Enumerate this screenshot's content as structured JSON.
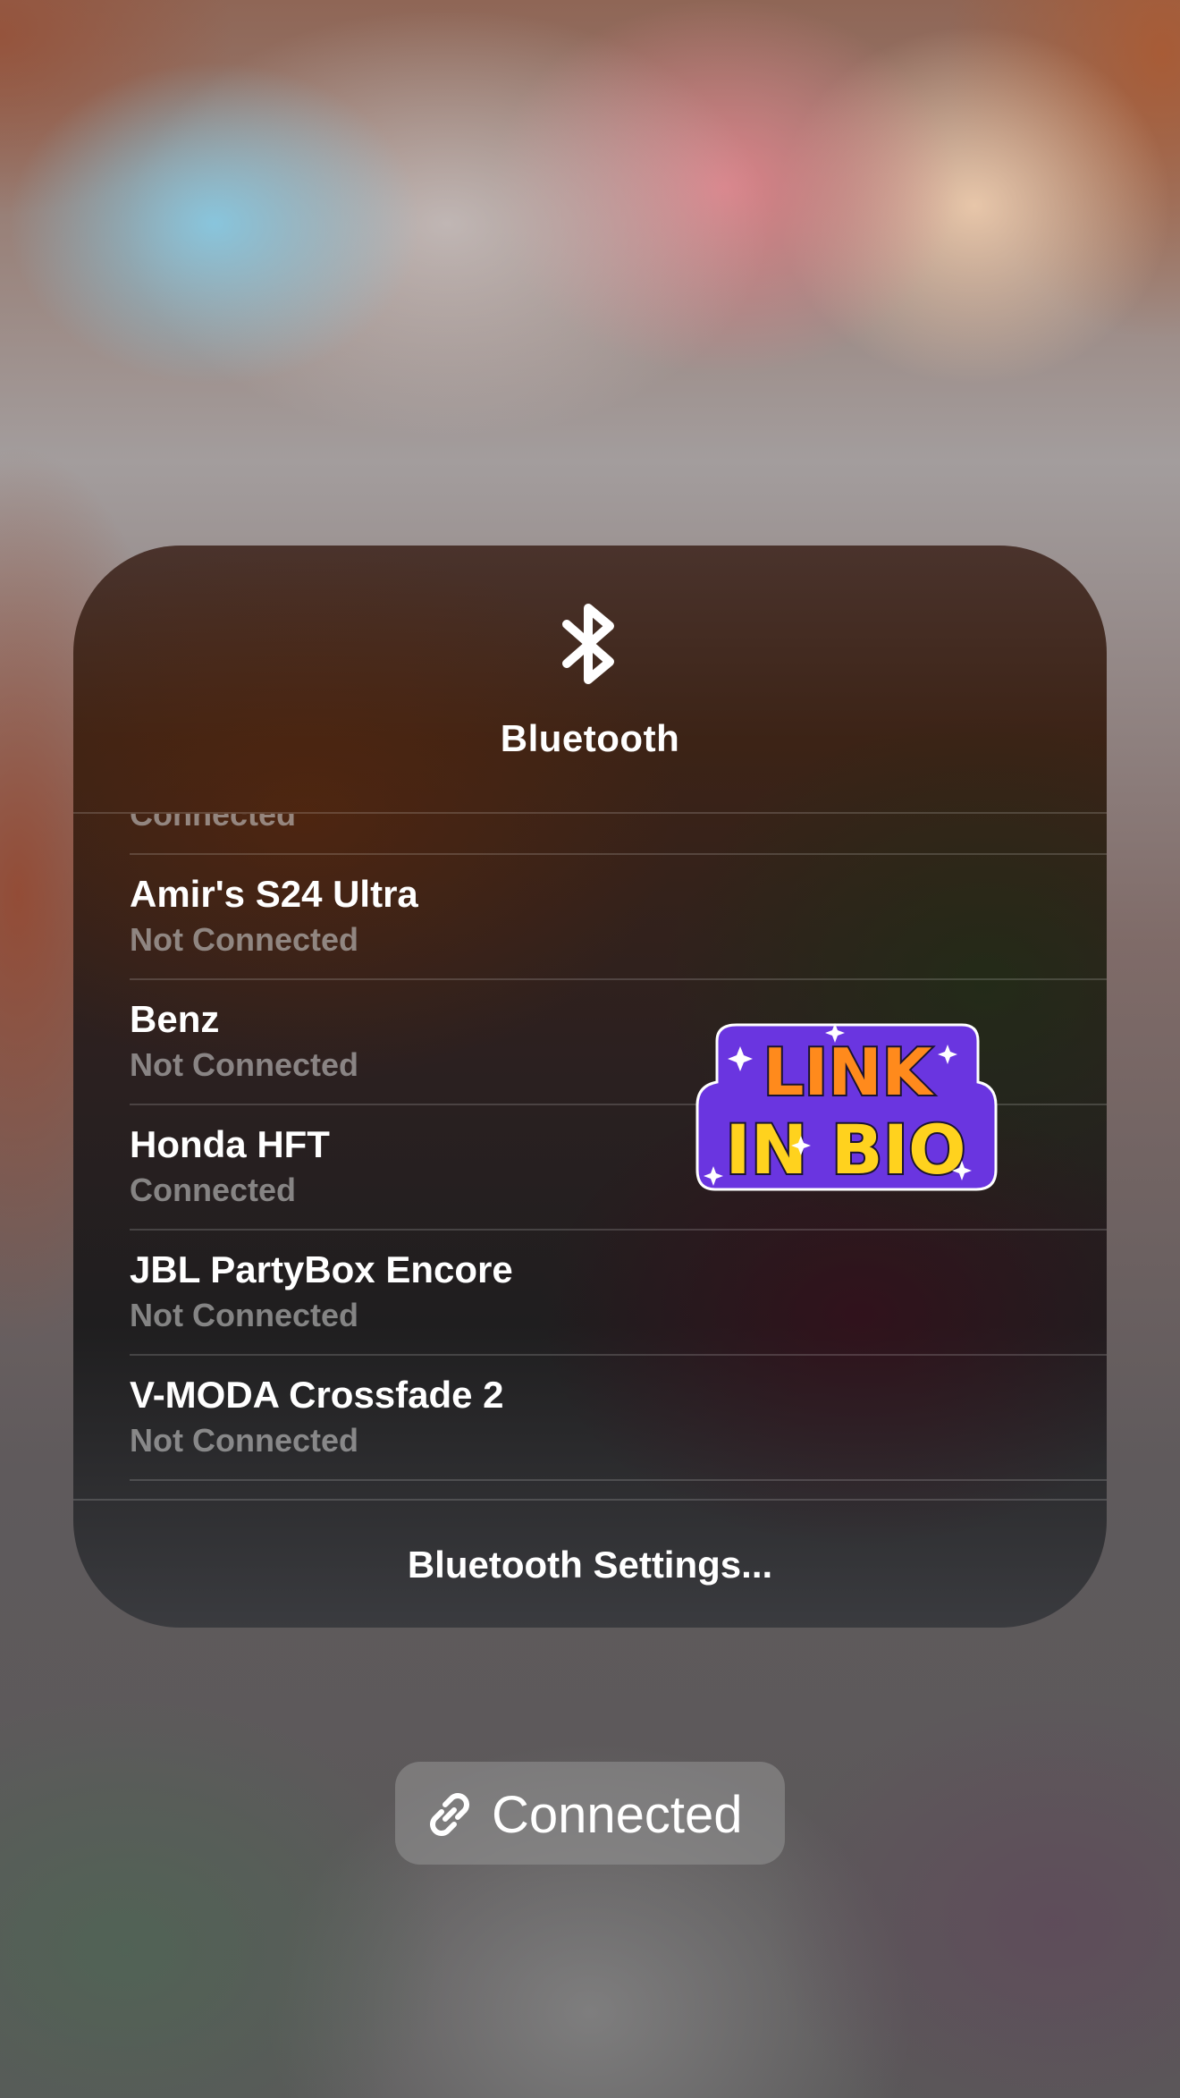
{
  "panel": {
    "title": "Bluetooth",
    "icon": "bluetooth-icon",
    "settings_label": "Bluetooth Settings..."
  },
  "devices": [
    {
      "name": "",
      "status": "Connected"
    },
    {
      "name": "Amir's S24 Ultra",
      "status": "Not Connected"
    },
    {
      "name": "Benz",
      "status": "Not Connected"
    },
    {
      "name": "Honda HFT",
      "status": "Connected"
    },
    {
      "name": "JBL PartyBox Encore",
      "status": "Not Connected"
    },
    {
      "name": "V-MODA Crossfade 2",
      "status": "Not Connected"
    }
  ],
  "sticker": {
    "line1": "LINK",
    "line2": "IN BIO"
  },
  "toast": {
    "icon": "link-icon",
    "label": "Connected"
  },
  "colors": {
    "sticker_purple": "#6a35e0",
    "sticker_orange": "#ff8a1c",
    "sticker_yellow": "#ffd21e"
  }
}
